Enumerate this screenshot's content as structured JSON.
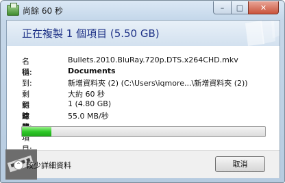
{
  "window": {
    "title": "尚餘 60 秒",
    "minimize_symbol": "–",
    "maximize_symbol": "□",
    "close_symbol": "✕"
  },
  "heading": "正在複製 1 個項目 (5.50 GB)",
  "details": [
    {
      "label": "名稱:",
      "value": "Bullets.2010.BluRay.720p.DTS.x264CHD.mkv",
      "bold": false
    },
    {
      "label": "從:",
      "value": "Documents",
      "bold": true
    },
    {
      "label": "到:",
      "value": "新增資料夾 (2) (C:\\Users\\iqmore...\\新增資料夾 (2))",
      "bold": false
    },
    {
      "label": "剩餘時間:",
      "value": "大約 60 秒",
      "bold": false
    },
    {
      "label": "剩餘的項目:",
      "value": "1 (4.80 GB)",
      "bold": false
    },
    {
      "label": "速度:",
      "value": "55.0 MB/秒",
      "bold": false
    }
  ],
  "progress_fraction": 0.12,
  "footer": {
    "details_toggle": "較少詳細資料",
    "cancel_label": "取消"
  },
  "colors": {
    "heading": "#1e3287",
    "progress": "#2fc829"
  }
}
